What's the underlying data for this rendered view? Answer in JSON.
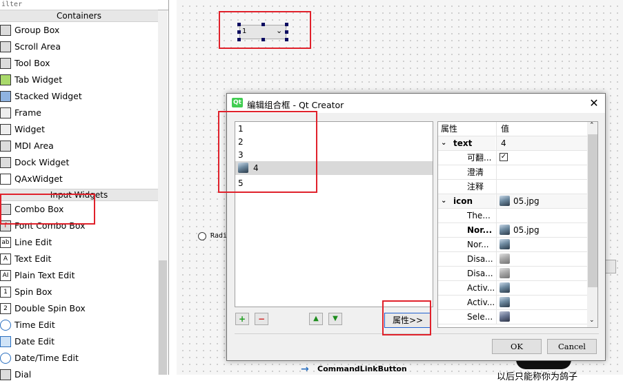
{
  "widget_box": {
    "filter_placeholder": "ilter",
    "categories": [
      {
        "label": "Containers"
      },
      {
        "label": "Input Widgets"
      }
    ],
    "containers": [
      {
        "label": "Group Box"
      },
      {
        "label": "Scroll Area"
      },
      {
        "label": "Tool Box"
      },
      {
        "label": "Tab Widget"
      },
      {
        "label": "Stacked Widget"
      },
      {
        "label": "Frame"
      },
      {
        "label": "Widget"
      },
      {
        "label": "MDI Area"
      },
      {
        "label": "Dock Widget"
      },
      {
        "label": "QAxWidget"
      }
    ],
    "inputs": [
      {
        "label": "Combo Box"
      },
      {
        "label": "Font Combo Box"
      },
      {
        "label": "Line Edit"
      },
      {
        "label": "Text Edit"
      },
      {
        "label": "Plain Text Edit"
      },
      {
        "label": "Spin Box"
      },
      {
        "label": "Double Spin Box"
      },
      {
        "label": "Time Edit"
      },
      {
        "label": "Date Edit"
      },
      {
        "label": "Date/Time Edit"
      },
      {
        "label": "Dial"
      }
    ]
  },
  "canvas": {
    "combo_value": "1",
    "radio_label": "Radi",
    "command_link_label": "CommandLinkButton",
    "bottom_text": "以后只能称你为鸽子"
  },
  "dialog": {
    "title": "编辑组合框 - Qt Creator",
    "items": [
      {
        "label": "1"
      },
      {
        "label": "2"
      },
      {
        "label": "3"
      },
      {
        "label": "4",
        "icon": "bird-icon",
        "selected": true
      },
      {
        "label": "5"
      }
    ],
    "add_symbol": "+",
    "remove_symbol": "−",
    "properties_button": "属性>>",
    "ok_button": "OK",
    "cancel_button": "Cancel",
    "property_table": {
      "header_name": "属性",
      "header_value": "值",
      "rows": [
        {
          "name": "text",
          "value": "4",
          "group": true
        },
        {
          "name": "可翻...",
          "value": "",
          "checked": true
        },
        {
          "name": "澄清",
          "value": ""
        },
        {
          "name": "注释",
          "value": ""
        },
        {
          "name": "icon",
          "value": "05.jpg",
          "group": true
        },
        {
          "name": "The...",
          "value": ""
        },
        {
          "name": "Nor...",
          "value": "05.jpg",
          "bold": true
        },
        {
          "name": "Nor...",
          "value": ""
        },
        {
          "name": "Disa...",
          "value": ""
        },
        {
          "name": "Disa...",
          "value": ""
        },
        {
          "name": "Activ...",
          "value": ""
        },
        {
          "name": "Activ...",
          "value": ""
        },
        {
          "name": "Sele...",
          "value": ""
        }
      ]
    }
  },
  "colors": {
    "highlight_red": "#e0202a",
    "qt_green": "#41cd52"
  }
}
